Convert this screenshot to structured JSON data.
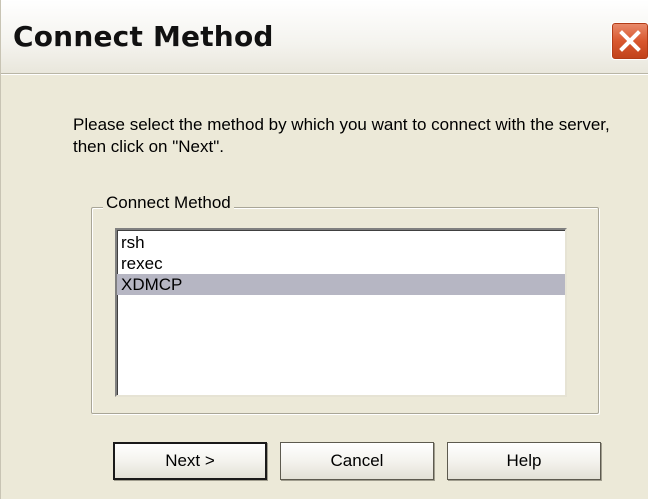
{
  "window": {
    "title": "Connect Method"
  },
  "instruction_text": "Please select the method by which you want to connect with the server, then click on \"Next\".",
  "group": {
    "label": "Connect Method",
    "items": [
      {
        "label": "rsh",
        "selected": false
      },
      {
        "label": "rexec",
        "selected": false
      },
      {
        "label": "XDMCP",
        "selected": true
      }
    ]
  },
  "buttons": {
    "next_label": "Next >",
    "cancel_label": "Cancel",
    "help_label": "Help"
  },
  "icons": {
    "close": "close-icon"
  },
  "colors": {
    "dialog_background": "#ece9d8",
    "selection_highlight": "#b6b6c3",
    "close_button": "#d9582f"
  }
}
